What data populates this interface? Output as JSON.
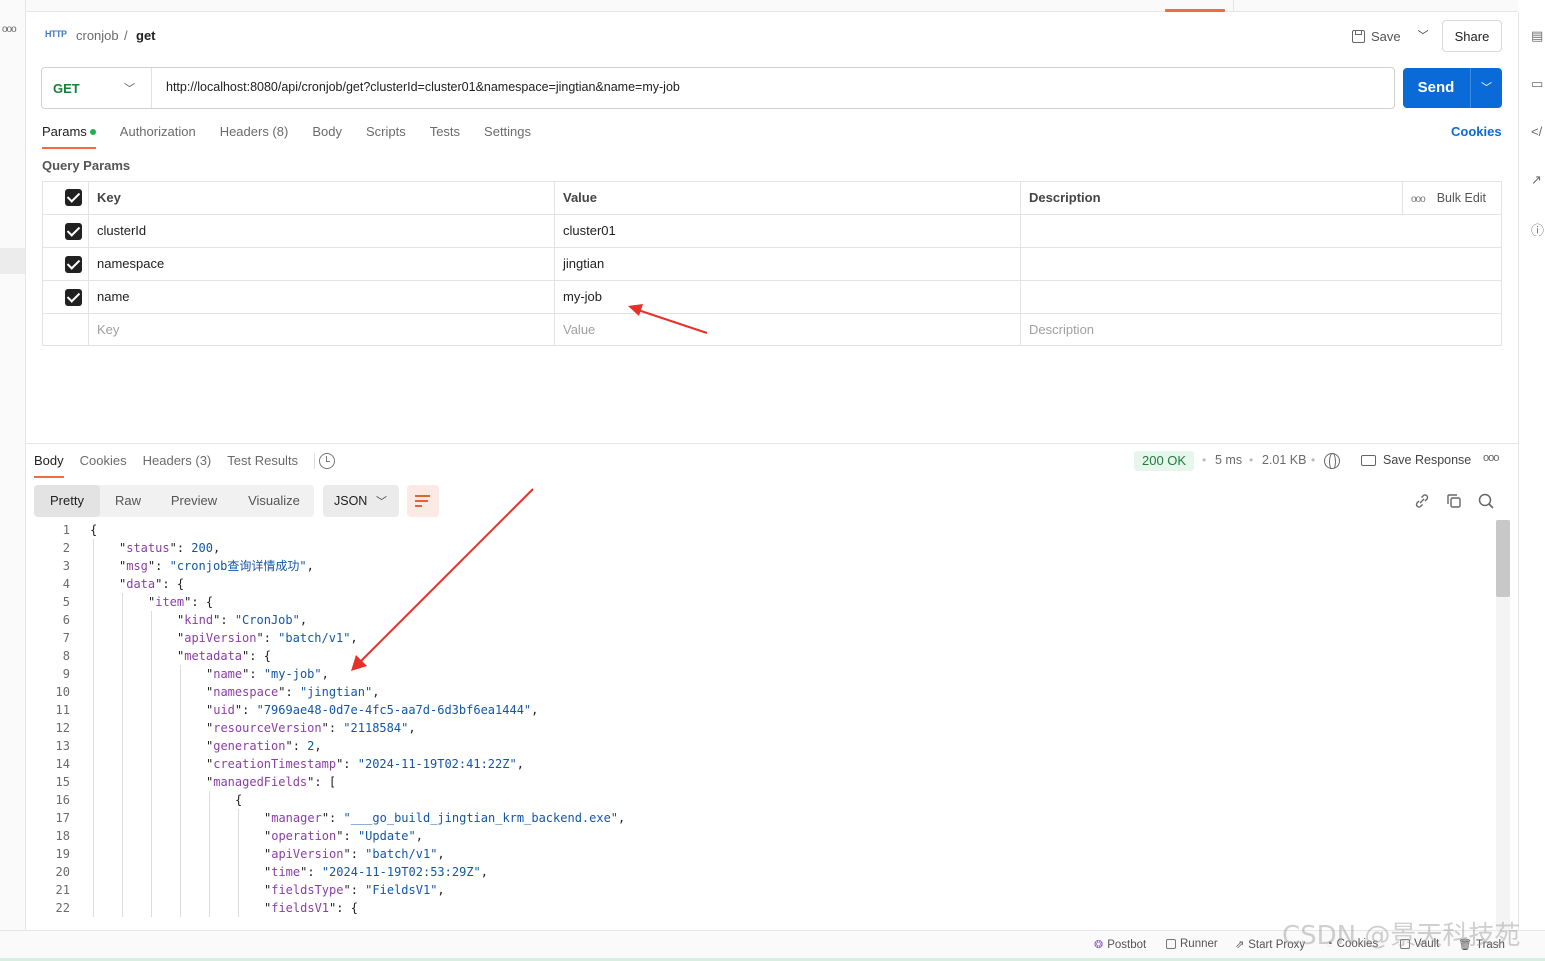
{
  "breadcrumb": {
    "icon": "http-icon",
    "icon_text": "HTTP",
    "parent": "cronjob",
    "separator": "/",
    "current": "get"
  },
  "header": {
    "save_label": "Save",
    "share_label": "Share"
  },
  "request": {
    "method": "GET",
    "url": "http://localhost:8080/api/cronjob/get?clusterId=cluster01&namespace=jingtian&name=my-job",
    "send_label": "Send"
  },
  "request_tabs": [
    {
      "label": "Params",
      "active": true,
      "dot": true
    },
    {
      "label": "Authorization"
    },
    {
      "label": "Headers (8)"
    },
    {
      "label": "Body"
    },
    {
      "label": "Scripts"
    },
    {
      "label": "Tests"
    },
    {
      "label": "Settings"
    }
  ],
  "cookies_label": "Cookies",
  "query_params": {
    "title": "Query Params",
    "headers": {
      "key": "Key",
      "value": "Value",
      "description": "Description",
      "bulk_edit": "Bulk Edit"
    },
    "rows": [
      {
        "key": "clusterId",
        "value": "cluster01",
        "checked": true
      },
      {
        "key": "namespace",
        "value": "jingtian",
        "checked": true
      },
      {
        "key": "name",
        "value": "my-job",
        "checked": true
      }
    ],
    "placeholder": {
      "key": "Key",
      "value": "Value",
      "description": "Description"
    }
  },
  "response_tabs": [
    {
      "label": "Body",
      "active": true
    },
    {
      "label": "Cookies"
    },
    {
      "label": "Headers (3)"
    },
    {
      "label": "Test Results"
    }
  ],
  "response_meta": {
    "status": "200 OK",
    "time": "5 ms",
    "size": "2.01 KB",
    "save_response": "Save Response"
  },
  "view_modes": [
    "Pretty",
    "Raw",
    "Preview",
    "Visualize"
  ],
  "active_view": "Pretty",
  "format": "JSON",
  "code_lines": [
    {
      "n": "1",
      "indent": 0,
      "t": "{"
    },
    {
      "n": "2",
      "indent": 1,
      "k": "status",
      "v": "200",
      "vt": "n",
      "tail": ","
    },
    {
      "n": "3",
      "indent": 1,
      "k": "msg",
      "v": "\"cronjob查询详情成功\"",
      "vt": "s",
      "tail": ","
    },
    {
      "n": "4",
      "indent": 1,
      "k": "data",
      "tail": ": {"
    },
    {
      "n": "5",
      "indent": 2,
      "k": "item",
      "tail": ": {"
    },
    {
      "n": "6",
      "indent": 3,
      "k": "kind",
      "v": "\"CronJob\"",
      "vt": "s",
      "tail": ","
    },
    {
      "n": "7",
      "indent": 3,
      "k": "apiVersion",
      "v": "\"batch/v1\"",
      "vt": "s",
      "tail": ","
    },
    {
      "n": "8",
      "indent": 3,
      "k": "metadata",
      "tail": ": {"
    },
    {
      "n": "9",
      "indent": 4,
      "k": "name",
      "v": "\"my-job\"",
      "vt": "s",
      "tail": ","
    },
    {
      "n": "10",
      "indent": 4,
      "k": "namespace",
      "v": "\"jingtian\"",
      "vt": "s",
      "tail": ","
    },
    {
      "n": "11",
      "indent": 4,
      "k": "uid",
      "v": "\"7969ae48-0d7e-4fc5-aa7d-6d3bf6ea1444\"",
      "vt": "s",
      "tail": ","
    },
    {
      "n": "12",
      "indent": 4,
      "k": "resourceVersion",
      "v": "\"2118584\"",
      "vt": "s",
      "tail": ","
    },
    {
      "n": "13",
      "indent": 4,
      "k": "generation",
      "v": "2",
      "vt": "n",
      "tail": ","
    },
    {
      "n": "14",
      "indent": 4,
      "k": "creationTimestamp",
      "v": "\"2024-11-19T02:41:22Z\"",
      "vt": "s",
      "tail": ","
    },
    {
      "n": "15",
      "indent": 4,
      "k": "managedFields",
      "tail": ": ["
    },
    {
      "n": "16",
      "indent": 5,
      "t": "{"
    },
    {
      "n": "17",
      "indent": 6,
      "k": "manager",
      "v": "\"___go_build_jingtian_krm_backend.exe\"",
      "vt": "s",
      "tail": ","
    },
    {
      "n": "18",
      "indent": 6,
      "k": "operation",
      "v": "\"Update\"",
      "vt": "s",
      "tail": ","
    },
    {
      "n": "19",
      "indent": 6,
      "k": "apiVersion",
      "v": "\"batch/v1\"",
      "vt": "s",
      "tail": ","
    },
    {
      "n": "20",
      "indent": 6,
      "k": "time",
      "v": "\"2024-11-19T02:53:29Z\"",
      "vt": "s",
      "tail": ","
    },
    {
      "n": "21",
      "indent": 6,
      "k": "fieldsType",
      "v": "\"FieldsV1\"",
      "vt": "s",
      "tail": ","
    },
    {
      "n": "22",
      "indent": 6,
      "k": "fieldsV1",
      "tail": ": {"
    }
  ],
  "footer": {
    "items": [
      "Postbot",
      "Runner",
      "Start Proxy",
      "Cookies",
      "Vault",
      "Trash"
    ]
  },
  "watermark": "CSDN @景天科技苑",
  "colors": {
    "accent": "#f26b3a",
    "send": "#0a6bd8",
    "method": "#1f7d3a",
    "annotation_arrow": "#e8302a"
  }
}
